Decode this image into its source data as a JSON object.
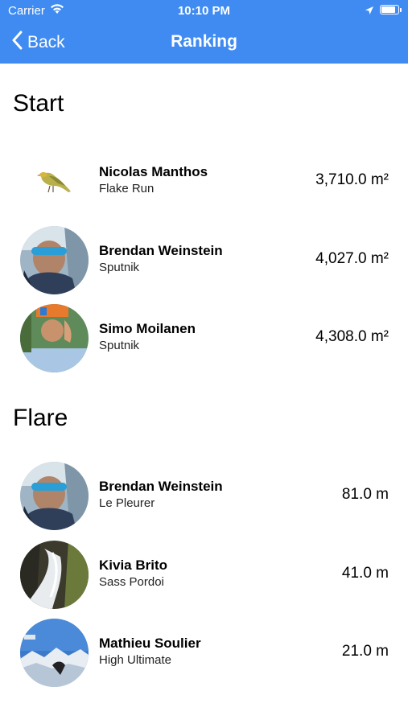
{
  "status_bar": {
    "carrier": "Carrier",
    "time": "10:10 PM"
  },
  "nav": {
    "back_label": "Back",
    "title": "Ranking"
  },
  "sections": [
    {
      "title": "Start",
      "rows": [
        {
          "name": "Nicolas Manthos",
          "subtitle": "Flake Run",
          "value": "3,710.0 m²",
          "avatar": "bird-icon"
        },
        {
          "name": "Brendan Weinstein",
          "subtitle": "Sputnik",
          "value": "4,027.0 m²",
          "avatar": "pilot-photo"
        },
        {
          "name": "Simo Moilanen",
          "subtitle": "Sputnik",
          "value": "4,308.0 m²",
          "avatar": "upside-down-photo"
        }
      ]
    },
    {
      "title": "Flare",
      "rows": [
        {
          "name": "Brendan Weinstein",
          "subtitle": "Le Pleurer",
          "value": "81.0 m",
          "avatar": "pilot-photo"
        },
        {
          "name": "Kivia Brito",
          "subtitle": "Sass Pordoi",
          "value": "41.0 m",
          "avatar": "waterfall-photo"
        },
        {
          "name": "Mathieu Soulier",
          "subtitle": "High Ultimate",
          "value": "21.0 m",
          "avatar": "mountain-sky-photo"
        }
      ]
    }
  ],
  "colors": {
    "nav_bar": "#3f8bf2",
    "text": "#000000"
  }
}
